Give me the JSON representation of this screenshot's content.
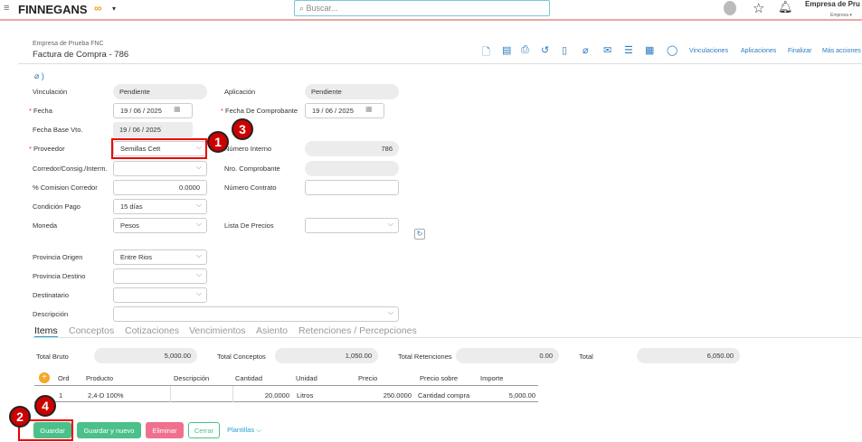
{
  "topbar": {
    "brand": "FINNEGANS",
    "search_placeholder": "Buscar...",
    "company": "Empresa de Pru",
    "company_sub": "Empresa ▾"
  },
  "header": {
    "company": "Empresa de Prueba FNC",
    "title": "Factura de Compra - 786",
    "links": [
      "Vinculaciones",
      "Aplicaciones",
      "Finalizar",
      "Más acciones"
    ]
  },
  "form": {
    "vinculacion": {
      "label": "Vinculación",
      "value": "Pendiente"
    },
    "aplicacion": {
      "label": "Aplicación",
      "value": "Pendiente"
    },
    "fecha": {
      "label": "Fecha",
      "value": "19 / 06 / 2025"
    },
    "fecha_comprobante": {
      "label": "Fecha De Comprobante",
      "value": "19 / 06 / 2025"
    },
    "fecha_base": {
      "label": "Fecha Base Vto.",
      "value": "19 / 06 / 2025"
    },
    "proveedor": {
      "label": "Proveedor",
      "value": "Semillas Cett"
    },
    "numero_interno": {
      "label": "Número Interno",
      "value": "786"
    },
    "corredor": {
      "label": "Corredor/Consig./Interm.",
      "value": ""
    },
    "nro_comprobante": {
      "label": "Nro. Comprobante",
      "value": ""
    },
    "comision": {
      "label": "% Comision Corredor",
      "value": "0.0000"
    },
    "numero_contrato": {
      "label": "Número Contrato",
      "value": ""
    },
    "condicion_pago": {
      "label": "Condición Pago",
      "value": "15 días"
    },
    "moneda": {
      "label": "Moneda",
      "value": "Pesos"
    },
    "lista_precios": {
      "label": "Lista De Precios",
      "value": ""
    },
    "provincia_origen": {
      "label": "Provincia Origen",
      "value": "Entre Rios"
    },
    "provincia_destino": {
      "label": "Provincia Destino",
      "value": ""
    },
    "destinatario": {
      "label": "Destinatario",
      "value": ""
    },
    "descripcion": {
      "label": "Descripción",
      "value": ""
    }
  },
  "tabs": [
    "Items",
    "Conceptos",
    "Cotizaciones",
    "Vencimientos",
    "Asiento",
    "Retenciones / Percepciones"
  ],
  "totals": {
    "bruto_label": "Total Bruto",
    "bruto": "5,000.00",
    "conceptos_label": "Total Conceptos",
    "conceptos": "1,050.00",
    "retenciones_label": "Total Retenciones",
    "retenciones": "0.00",
    "total_label": "Total",
    "total": "6,050.00"
  },
  "table": {
    "headers": [
      "Ord",
      "Producto",
      "Descripción",
      "Cantidad",
      "Unidad",
      "Precio",
      "Precio sobre",
      "Importe"
    ],
    "rows": [
      [
        "1",
        "2,4-D 100%",
        "",
        "20.0000",
        "Litros",
        "250.0000",
        "Cantidad compra",
        "5,000.00"
      ]
    ]
  },
  "buttons": {
    "guardar": "Guardar",
    "guardar_nuevo": "Guardar y nuevo",
    "eliminar": "Eliminar",
    "cerrar": "Cerrar",
    "plantillas": "Plantillas ⌵"
  },
  "annotations": [
    "1",
    "2",
    "3",
    "4"
  ]
}
